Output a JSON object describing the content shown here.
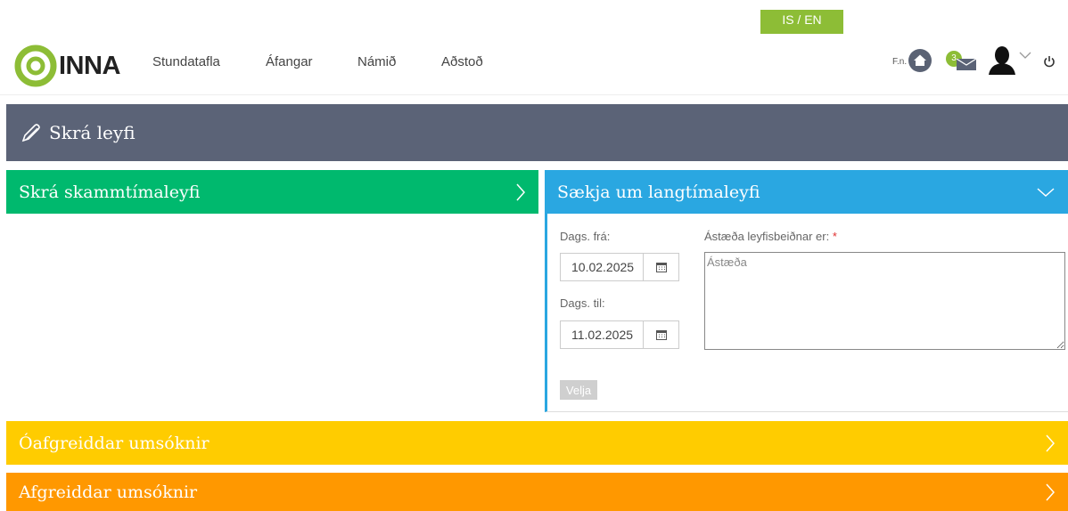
{
  "header": {
    "lang_toggle": "IS / EN",
    "logo_text": "INNA",
    "nav": [
      "Stundatafla",
      "Áfangar",
      "Námið",
      "Aðstoð"
    ],
    "fn_label": "F.n.",
    "mail_count": "3"
  },
  "page_title": "Skrá leyfi",
  "panels": {
    "short_leave": "Skrá skammtímaleyfi",
    "long_leave": "Sækja um langtímaleyfi",
    "pending": "Óafgreiddar umsóknir",
    "processed": "Afgreiddar umsóknir"
  },
  "form": {
    "date_from_label": "Dags. frá:",
    "date_from_value": "10.02.2025",
    "date_to_label": "Dags. til:",
    "date_to_value": "11.02.2025",
    "reason_label": "Ástæða leyfisbeiðnar er:",
    "reason_required": "*",
    "reason_placeholder": "Ástæða",
    "submit_label": "Velja"
  },
  "colors": {
    "green": "#00b96e",
    "blue": "#2aa7e1",
    "yellow": "#ffcc00",
    "orange": "#ff9800",
    "slate": "#5b6377",
    "lime": "#8dbd36"
  }
}
